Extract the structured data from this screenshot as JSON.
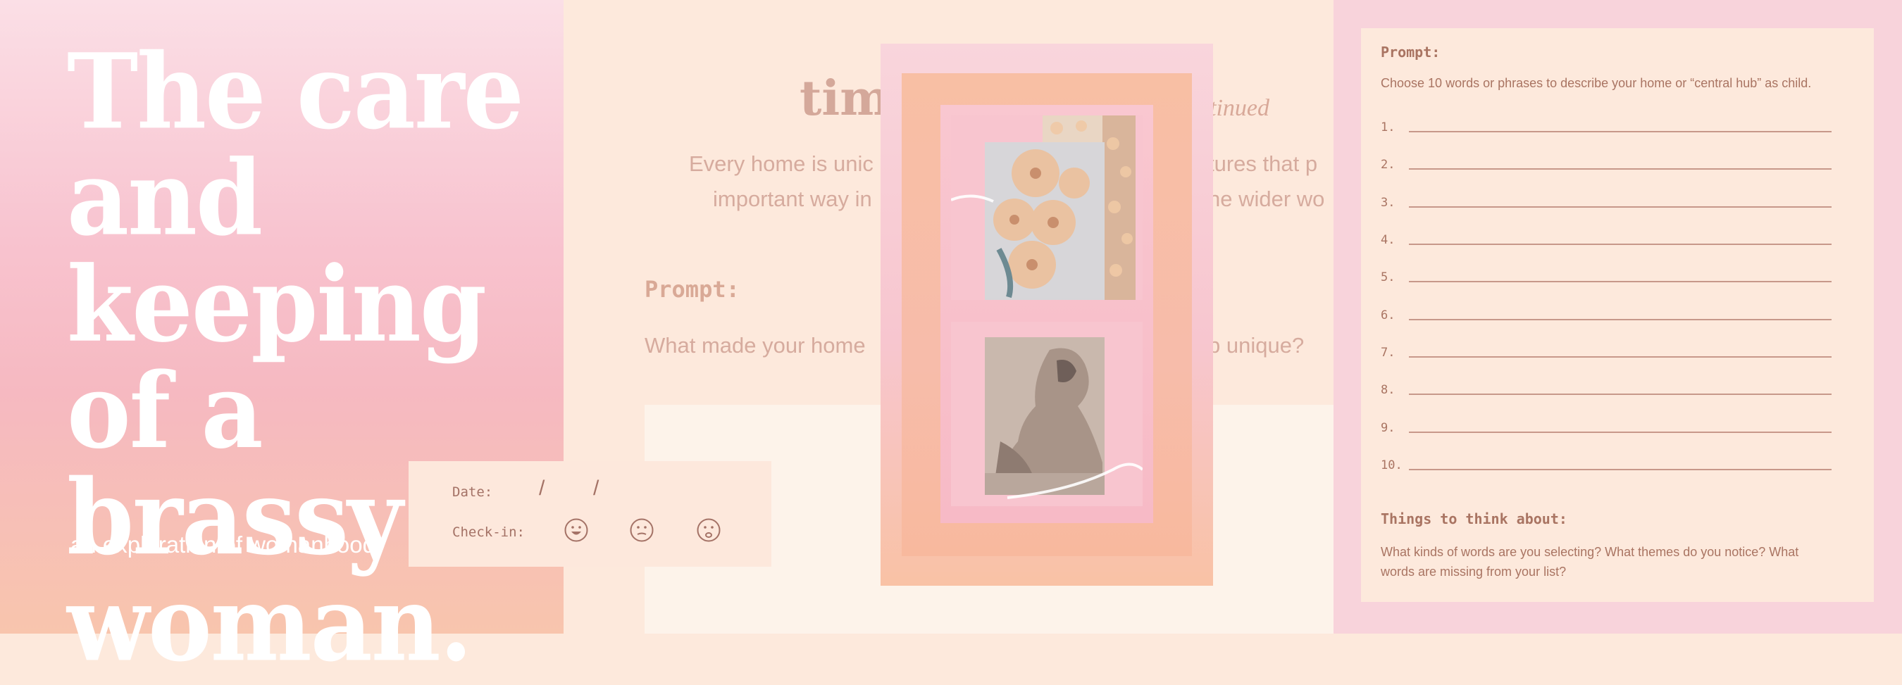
{
  "cover": {
    "title": "The care and keeping of a brassy woman.",
    "subtitle": "an exploration of womanhood"
  },
  "middle_page": {
    "heading_visible": "tim",
    "continued_visible": "ntinued",
    "body_line_1_left": "Every home is unic",
    "body_line_1_right": "tures that p",
    "body_line_2_left": "important way in",
    "body_line_2_right": "he wider wo",
    "prompt_label": "Prompt:",
    "question_left": "What made your home",
    "question_right": "p unique?"
  },
  "checkin_card": {
    "date_label": "Date:",
    "date_separators": [
      "/",
      "/"
    ],
    "checkin_label": "Check-in:",
    "moods": [
      "happy-face-icon",
      "neutral-face-icon",
      "sad-face-icon"
    ]
  },
  "photo_card": {
    "images": [
      "peony-flowers-photo",
      "classical-statue-photo"
    ]
  },
  "worksheet": {
    "prompt_label": "Prompt:",
    "instruction": "Choose 10 words or phrases to describe your home or “central hub” as child.",
    "rows": [
      "1.",
      "2.",
      "3.",
      "4.",
      "5.",
      "6.",
      "7.",
      "8.",
      "9.",
      "10."
    ],
    "think_label": "Things to think about:",
    "think_text": "What kinds of words are you selecting? What themes do you notice? What words are missing from your list?"
  },
  "colors": {
    "cover_pink": "#f8c3cf",
    "cover_peach": "#f8c5ad",
    "page_cream": "#fde9dc",
    "worksheet_bg": "#f8d3db",
    "ink_brown": "#a97462"
  }
}
